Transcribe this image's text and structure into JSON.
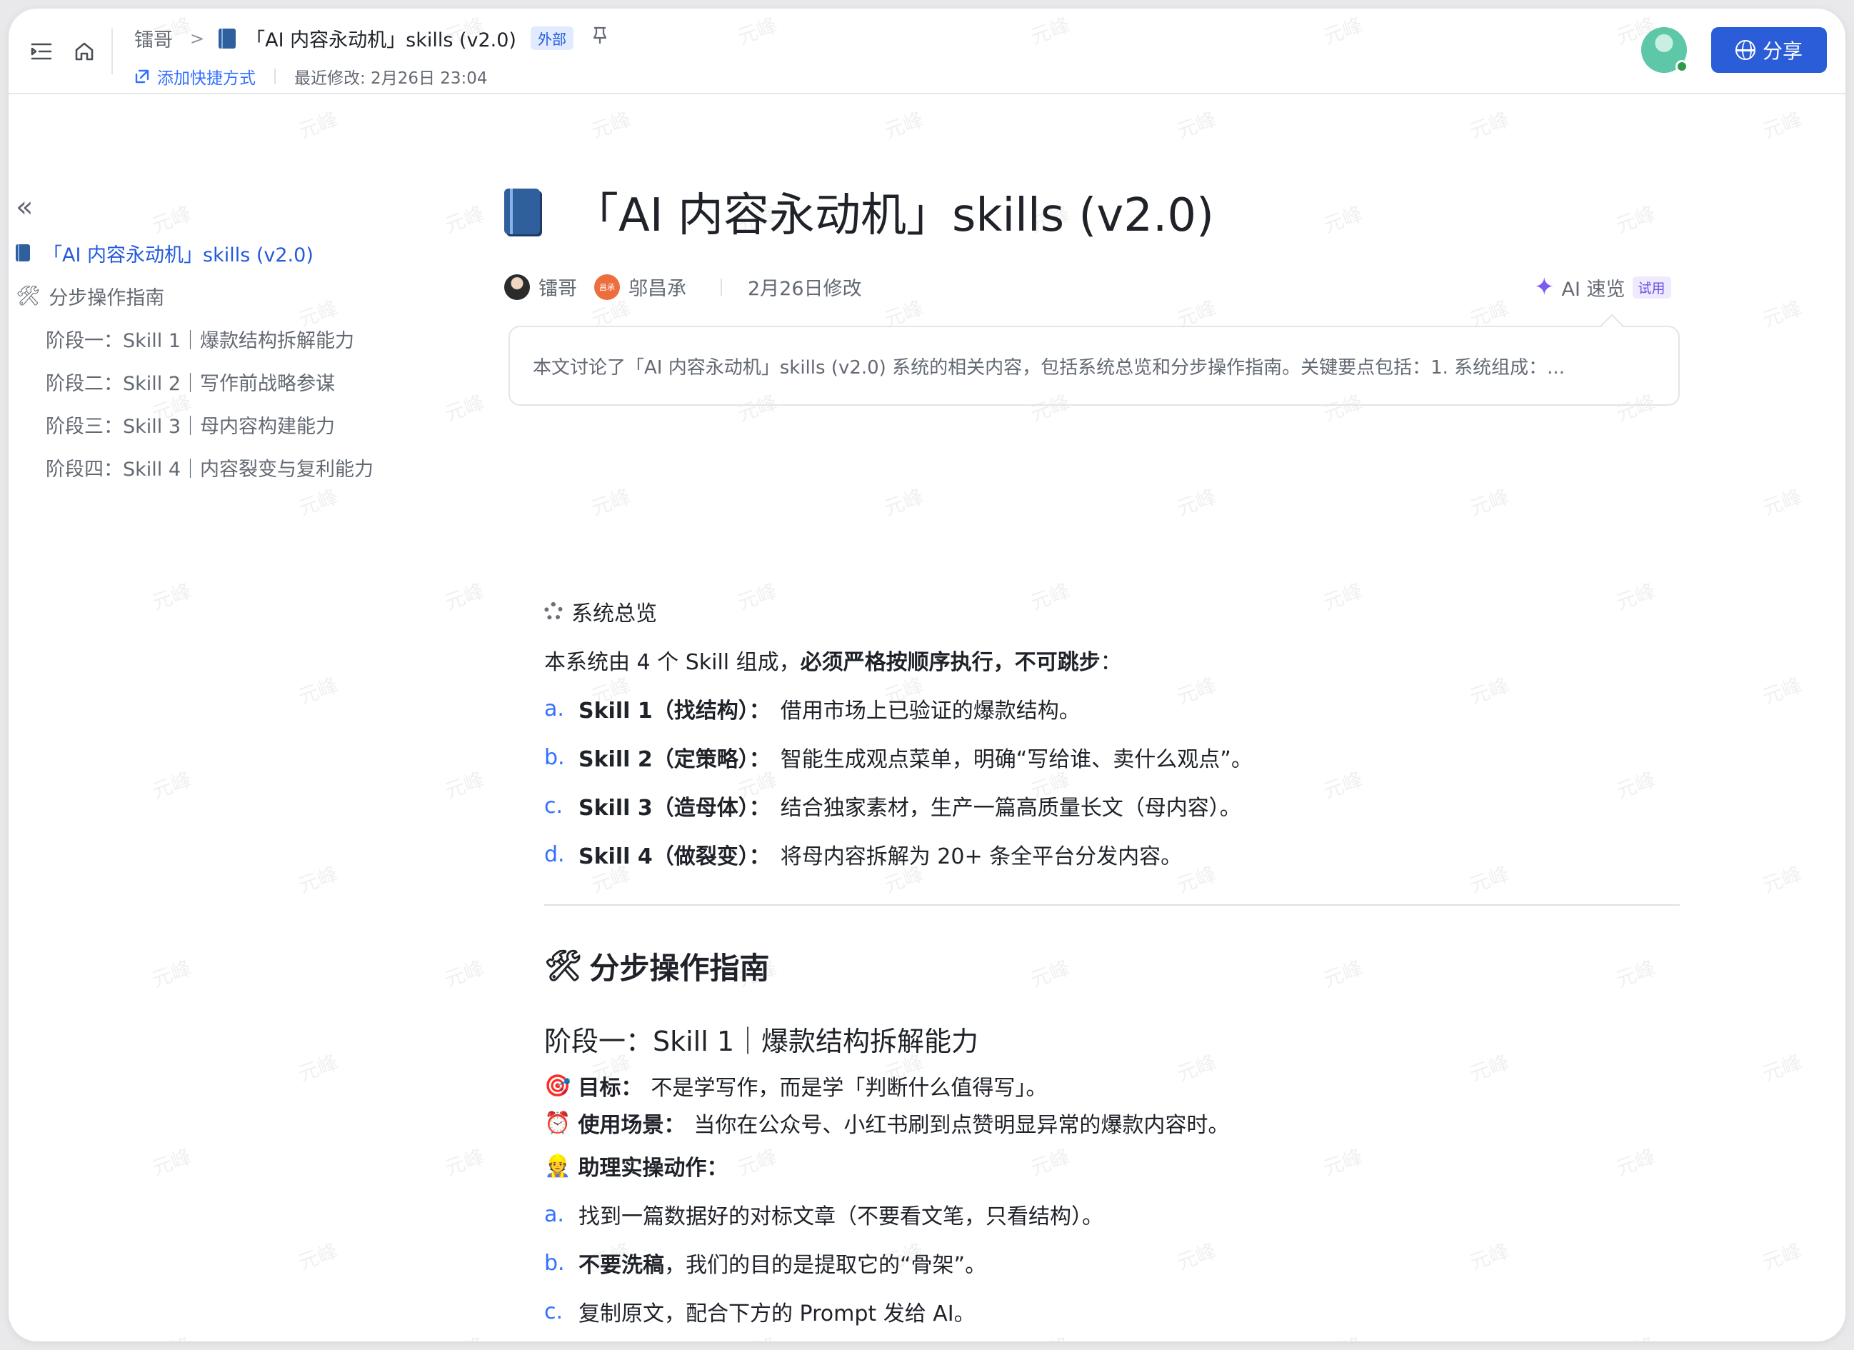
{
  "header": {
    "breadcrumb_root": "镭哥",
    "doc_title": "「AI 内容永动机」skills (v2.0)",
    "external_badge": "外部",
    "add_shortcut": "添加快捷方式",
    "last_modified": "最近修改: 2月26日 23:04",
    "share_label": "分享"
  },
  "outline": {
    "items": [
      {
        "label": "「AI 内容永动机」skills (v2.0)",
        "level": 1,
        "active": true
      },
      {
        "label": "分步操作指南",
        "level": 1,
        "active": false
      },
      {
        "label": "阶段一：Skill 1｜爆款结构拆解能力",
        "level": 2,
        "active": false
      },
      {
        "label": "阶段二：Skill 2｜写作前战略参谋",
        "level": 2,
        "active": false
      },
      {
        "label": "阶段三：Skill 3｜母内容构建能力",
        "level": 2,
        "active": false
      },
      {
        "label": "阶段四：Skill 4｜内容裂变与复利能力",
        "level": 2,
        "active": false
      }
    ]
  },
  "document": {
    "title": "「AI 内容永动机」skills (v2.0)",
    "author1": "镭哥",
    "author2": "邬昌承",
    "author2_avatar_text": "昌承",
    "modified": "2月26日修改",
    "ai_quick": "AI 速览",
    "trial_badge": "试用",
    "summary": "本文讨论了「AI 内容永动机」skills (v2.0) 系统的相关内容，包括系统总览和分步操作指南。关键要点包括：1. 系统组成：...",
    "overview_heading": "系统总览",
    "overview_intro_plain": "本系统由 4 个 Skill 组成，",
    "overview_intro_bold": "必须严格按顺序执行，不可跳步",
    "overview_intro_end": "：",
    "skills": [
      {
        "mark": "a.",
        "name": "Skill 1（找结构）：",
        "desc": "借用市场上已验证的爆款结构。"
      },
      {
        "mark": "b.",
        "name": "Skill 2（定策略）：",
        "desc": "智能生成观点菜单，明确“写给谁、卖什么观点”。"
      },
      {
        "mark": "c.",
        "name": "Skill 3（造母体）：",
        "desc": "结合独家素材，生产一篇高质量长文（母内容）。"
      },
      {
        "mark": "d.",
        "name": "Skill 4（做裂变）：",
        "desc": "将母内容拆解为 20+ 条全平台分发内容。"
      }
    ],
    "guide_heading": "分步操作指南",
    "stage1_heading": "阶段一：Skill 1｜爆款结构拆解能力",
    "goal_label": "目标：",
    "goal_text": "不是学写作，而是学「判断什么值得写」。",
    "scene_label": "使用场景：",
    "scene_text": "当你在公众号、小红书刷到点赞明显异常的爆款内容时。",
    "actions_label": "助理实操动作：",
    "actions": [
      {
        "mark": "a.",
        "bold": "",
        "text": "找到一篇数据好的对标文章（不要看文笔，只看结构）。"
      },
      {
        "mark": "b.",
        "bold": "不要洗稿",
        "text": "，我们的目的是提取它的“骨架”。"
      },
      {
        "mark": "c.",
        "bold": "",
        "text": "复制原文，配合下方的 Prompt 发给 AI。"
      }
    ]
  },
  "watermark_text": "元峰",
  "colors": {
    "accent": "#2c5dd9",
    "link": "#3370ff",
    "outline_active": "#245bdb"
  }
}
